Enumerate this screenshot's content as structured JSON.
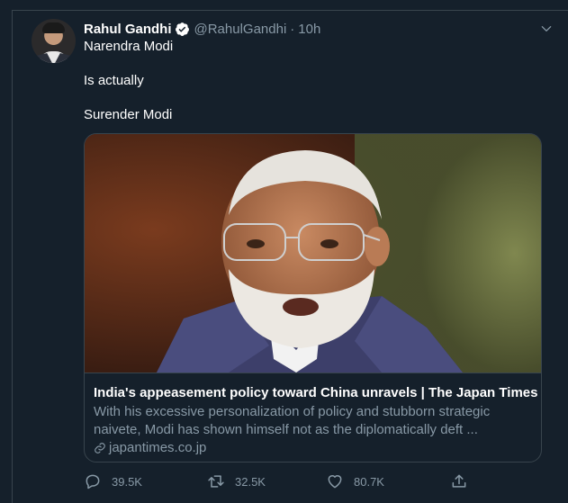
{
  "tweet": {
    "author_name": "Rahul Gandhi",
    "handle": "@RahulGandhi",
    "separator": "·",
    "time": "10h",
    "lines": [
      "Narendra Modi",
      "Is actually",
      "Surender Modi"
    ]
  },
  "card": {
    "title": "India's appeasement policy toward China unravels | The Japan Times",
    "description": "With his excessive personalization of policy and stubborn strategic naivete, Modi has shown himself not as the diplomatically deft ...",
    "domain": "japantimes.co.jp"
  },
  "actions": {
    "reply_count": "39.5K",
    "retweet_count": "32.5K",
    "like_count": "80.7K"
  },
  "icons": {
    "verified": "verified-badge-icon",
    "caret": "chevron-down-icon",
    "link": "link-icon",
    "reply": "reply-icon",
    "retweet": "retweet-icon",
    "like": "heart-icon",
    "share": "share-icon"
  },
  "colors": {
    "background": "#15202b",
    "border": "#38444d",
    "secondary_text": "#8899a6",
    "primary_text": "#ffffff"
  }
}
